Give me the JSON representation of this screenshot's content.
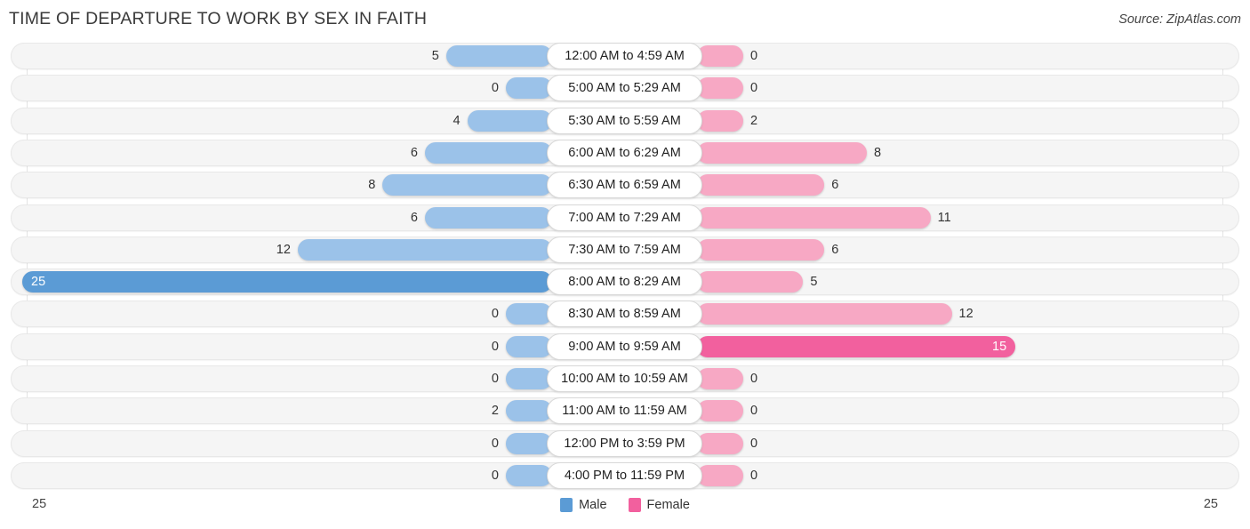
{
  "header": {
    "title": "TIME OF DEPARTURE TO WORK BY SEX IN FAITH",
    "source": "Source: ZipAtlas.com"
  },
  "legend": {
    "male_label": "Male",
    "female_label": "Female",
    "male_color": "#5B9BD5",
    "female_color": "#F2609E"
  },
  "axis": {
    "left_end": "25",
    "right_end": "25",
    "max": 25
  },
  "colors": {
    "male_low": "#9BC2E9",
    "male_high": "#5B9BD5",
    "female_low": "#F7A8C4",
    "female_high": "#F2609E",
    "track": "#f5f5f5",
    "pill": "#ffffff"
  },
  "chart_data": {
    "type": "bar",
    "title": "TIME OF DEPARTURE TO WORK BY SEX IN FAITH",
    "orientation": "horizontal-diverging",
    "xlabel": "",
    "ylabel": "",
    "xlim": [
      25,
      25
    ],
    "grid": true,
    "legend_position": "bottom-center",
    "categories": [
      "12:00 AM to 4:59 AM",
      "5:00 AM to 5:29 AM",
      "5:30 AM to 5:59 AM",
      "6:00 AM to 6:29 AM",
      "6:30 AM to 6:59 AM",
      "7:00 AM to 7:29 AM",
      "7:30 AM to 7:59 AM",
      "8:00 AM to 8:29 AM",
      "8:30 AM to 8:59 AM",
      "9:00 AM to 9:59 AM",
      "10:00 AM to 10:59 AM",
      "11:00 AM to 11:59 AM",
      "12:00 PM to 3:59 PM",
      "4:00 PM to 11:59 PM"
    ],
    "series": [
      {
        "name": "Male",
        "values": [
          5,
          0,
          4,
          6,
          8,
          6,
          12,
          25,
          0,
          0,
          0,
          2,
          0,
          0
        ]
      },
      {
        "name": "Female",
        "values": [
          0,
          0,
          2,
          8,
          6,
          11,
          6,
          5,
          12,
          15,
          0,
          0,
          0,
          0
        ]
      }
    ]
  },
  "rows": [
    {
      "label": "12:00 AM to 4:59 AM",
      "male": "5",
      "female": "0"
    },
    {
      "label": "5:00 AM to 5:29 AM",
      "male": "0",
      "female": "0"
    },
    {
      "label": "5:30 AM to 5:59 AM",
      "male": "4",
      "female": "2"
    },
    {
      "label": "6:00 AM to 6:29 AM",
      "male": "6",
      "female": "8"
    },
    {
      "label": "6:30 AM to 6:59 AM",
      "male": "8",
      "female": "6"
    },
    {
      "label": "7:00 AM to 7:29 AM",
      "male": "6",
      "female": "11"
    },
    {
      "label": "7:30 AM to 7:59 AM",
      "male": "12",
      "female": "6"
    },
    {
      "label": "8:00 AM to 8:29 AM",
      "male": "25",
      "female": "5"
    },
    {
      "label": "8:30 AM to 8:59 AM",
      "male": "0",
      "female": "12"
    },
    {
      "label": "9:00 AM to 9:59 AM",
      "male": "0",
      "female": "15"
    },
    {
      "label": "10:00 AM to 10:59 AM",
      "male": "0",
      "female": "0"
    },
    {
      "label": "11:00 AM to 11:59 AM",
      "male": "2",
      "female": "0"
    },
    {
      "label": "12:00 PM to 3:59 PM",
      "male": "0",
      "female": "0"
    },
    {
      "label": "4:00 PM to 11:59 PM",
      "male": "0",
      "female": "0"
    }
  ]
}
